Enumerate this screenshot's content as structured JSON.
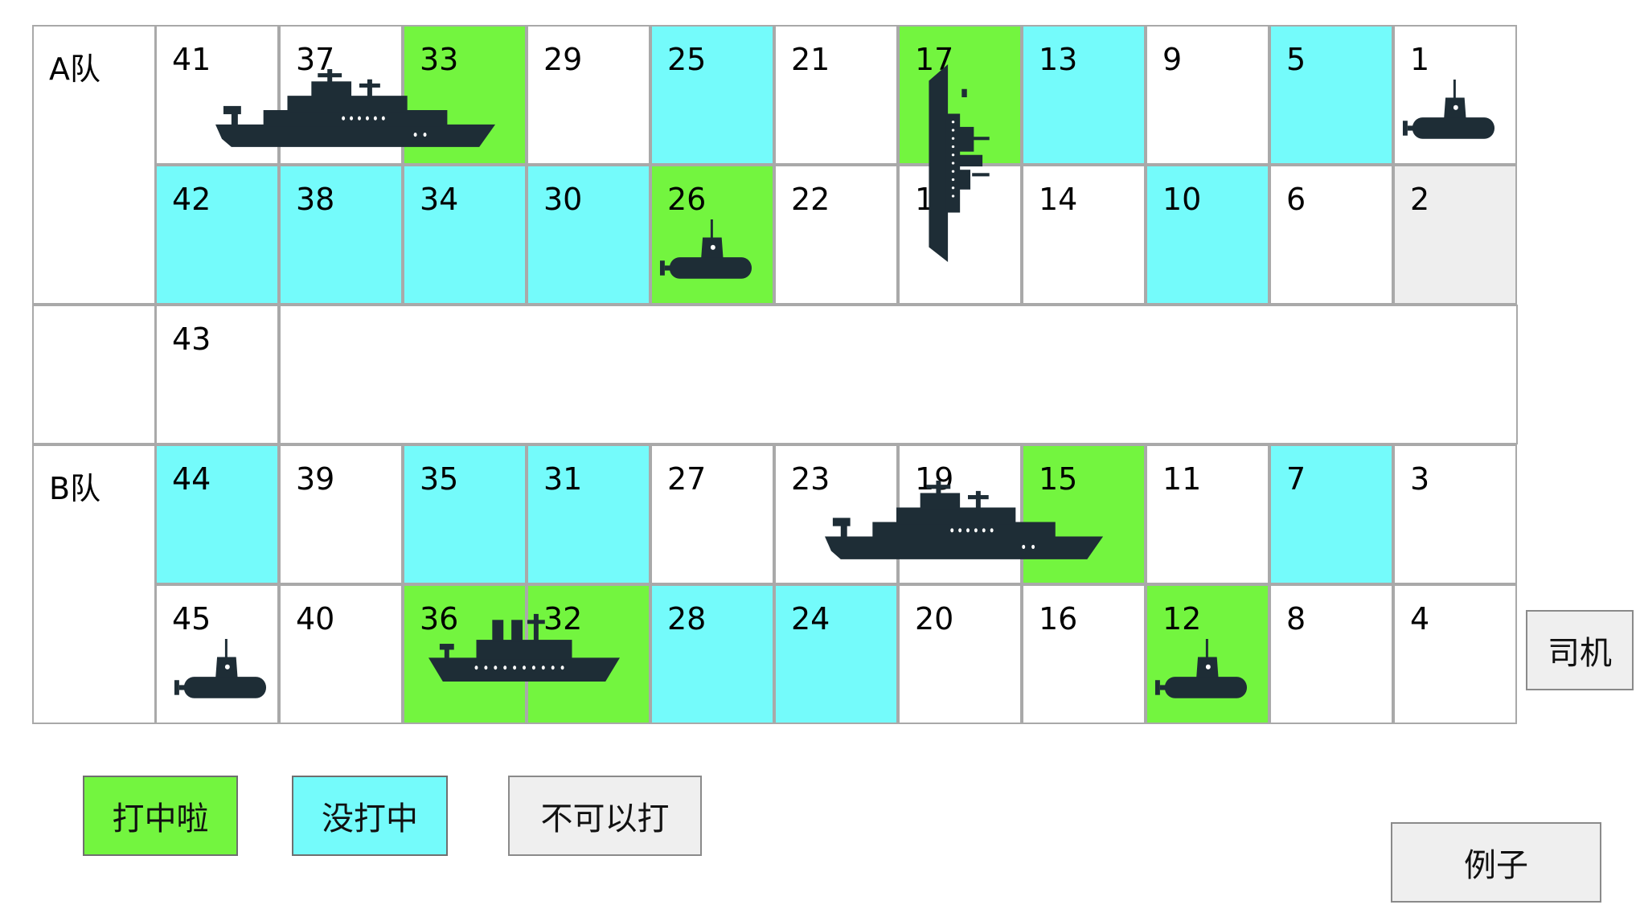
{
  "teams": {
    "a": {
      "label": "A队"
    },
    "b": {
      "label": "B队"
    }
  },
  "cells": {
    "a_row1": [
      {
        "num": "41",
        "state": "empty"
      },
      {
        "num": "37",
        "state": "empty"
      },
      {
        "num": "33",
        "state": "hit"
      },
      {
        "num": "29",
        "state": "empty"
      },
      {
        "num": "25",
        "state": "miss"
      },
      {
        "num": "21",
        "state": "empty"
      },
      {
        "num": "17",
        "state": "hit"
      },
      {
        "num": "13",
        "state": "miss"
      },
      {
        "num": "9",
        "state": "empty"
      },
      {
        "num": "5",
        "state": "miss"
      },
      {
        "num": "1",
        "state": "empty"
      }
    ],
    "a_row2": [
      {
        "num": "42",
        "state": "miss"
      },
      {
        "num": "38",
        "state": "miss"
      },
      {
        "num": "34",
        "state": "miss"
      },
      {
        "num": "30",
        "state": "miss"
      },
      {
        "num": "26",
        "state": "hit"
      },
      {
        "num": "22",
        "state": "empty"
      },
      {
        "num": "18",
        "state": "empty"
      },
      {
        "num": "14",
        "state": "empty"
      },
      {
        "num": "10",
        "state": "miss"
      },
      {
        "num": "6",
        "state": "empty"
      },
      {
        "num": "2",
        "state": "blocked"
      }
    ],
    "middle": {
      "num": "43",
      "state": "empty"
    },
    "b_row1": [
      {
        "num": "44",
        "state": "miss"
      },
      {
        "num": "39",
        "state": "empty"
      },
      {
        "num": "35",
        "state": "miss"
      },
      {
        "num": "31",
        "state": "miss"
      },
      {
        "num": "27",
        "state": "empty"
      },
      {
        "num": "23",
        "state": "empty"
      },
      {
        "num": "19",
        "state": "empty"
      },
      {
        "num": "15",
        "state": "hit"
      },
      {
        "num": "11",
        "state": "empty"
      },
      {
        "num": "7",
        "state": "miss"
      },
      {
        "num": "3",
        "state": "empty"
      }
    ],
    "b_row2": [
      {
        "num": "45",
        "state": "empty"
      },
      {
        "num": "40",
        "state": "empty"
      },
      {
        "num": "36",
        "state": "hit"
      },
      {
        "num": "32",
        "state": "hit"
      },
      {
        "num": "28",
        "state": "miss"
      },
      {
        "num": "24",
        "state": "miss"
      },
      {
        "num": "20",
        "state": "empty"
      },
      {
        "num": "16",
        "state": "empty"
      },
      {
        "num": "12",
        "state": "hit"
      },
      {
        "num": "8",
        "state": "empty"
      },
      {
        "num": "4",
        "state": "empty"
      }
    ]
  },
  "ships": [
    {
      "type": "cruiser-icon",
      "team": "A",
      "cells": [
        "41",
        "37",
        "33"
      ]
    },
    {
      "type": "battleship-vertical-icon",
      "team": "A",
      "cells": [
        "17",
        "18"
      ]
    },
    {
      "type": "submarine-icon",
      "team": "A",
      "cells": [
        "1"
      ]
    },
    {
      "type": "submarine-icon",
      "team": "A",
      "cells": [
        "26"
      ]
    },
    {
      "type": "cruiser-icon",
      "team": "B",
      "cells": [
        "23",
        "19",
        "15"
      ]
    },
    {
      "type": "destroyer-icon",
      "team": "B",
      "cells": [
        "36",
        "32"
      ]
    },
    {
      "type": "submarine-icon",
      "team": "B",
      "cells": [
        "45"
      ]
    },
    {
      "type": "submarine-icon",
      "team": "B",
      "cells": [
        "12"
      ]
    }
  ],
  "legend": {
    "hit_label": "打中啦",
    "miss_label": "没打中",
    "blocked_label": "不可以打"
  },
  "buttons": {
    "driver_label": "司机",
    "example_label": "例子"
  },
  "colors": {
    "hit": "#73f53f",
    "miss": "#74fbfb",
    "blocked": "#eeeeee",
    "grid": "#a9a9a9",
    "ship": "#1e2d36"
  }
}
